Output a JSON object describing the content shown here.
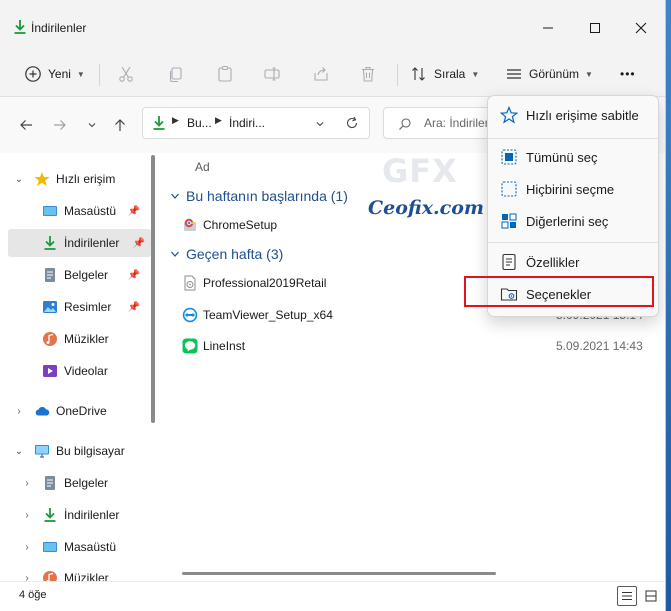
{
  "window": {
    "title": "İndirilenler"
  },
  "toolbar": {
    "new_label": "Yeni",
    "sort_label": "Sırala",
    "view_label": "Görünüm",
    "more_label": "•••"
  },
  "address": {
    "segment1": "Bu...",
    "segment2": "İndiri...",
    "search_placeholder": "Ara: İndirilen"
  },
  "sidebar": {
    "quick_access": "Hızlı erişim",
    "items": [
      {
        "label": "Masaüstü"
      },
      {
        "label": "İndirilenler"
      },
      {
        "label": "Belgeler"
      },
      {
        "label": "Resimler"
      },
      {
        "label": "Müzikler"
      },
      {
        "label": "Videolar"
      }
    ],
    "onedrive": "OneDrive",
    "this_pc": "Bu bilgisayar",
    "pc_items": [
      {
        "label": "Belgeler"
      },
      {
        "label": "İndirilenler"
      },
      {
        "label": "Masaüstü"
      },
      {
        "label": "Müzikler"
      }
    ]
  },
  "content": {
    "column_name": "Ad",
    "groups": [
      {
        "title": "Bu haftanın başlarında (1)",
        "files": [
          {
            "name": "ChromeSetup",
            "date": ""
          }
        ]
      },
      {
        "title": "Geçen hafta (3)",
        "files": [
          {
            "name": "Professional2019Retail",
            "date": ""
          },
          {
            "name": "TeamViewer_Setup_x64",
            "date": "5.09.2021 15:14"
          },
          {
            "name": "LineInst",
            "date": "5.09.2021 14:43"
          }
        ]
      }
    ]
  },
  "watermark": {
    "logo_text": "GFX",
    "site_text": "Ceofix.com"
  },
  "menu": {
    "pin": "Hızlı erişime sabitle",
    "select_all": "Tümünü seç",
    "select_none": "Hiçbirini seçme",
    "invert": "Diğerlerini seç",
    "properties": "Özellikler",
    "options": "Seçenekler"
  },
  "status": {
    "count": "4 öğe"
  },
  "colors": {
    "accent": "#0067c0",
    "download_green": "#1a9a3c",
    "highlight_red": "#e0141e",
    "group_blue": "#1f4f8e"
  }
}
